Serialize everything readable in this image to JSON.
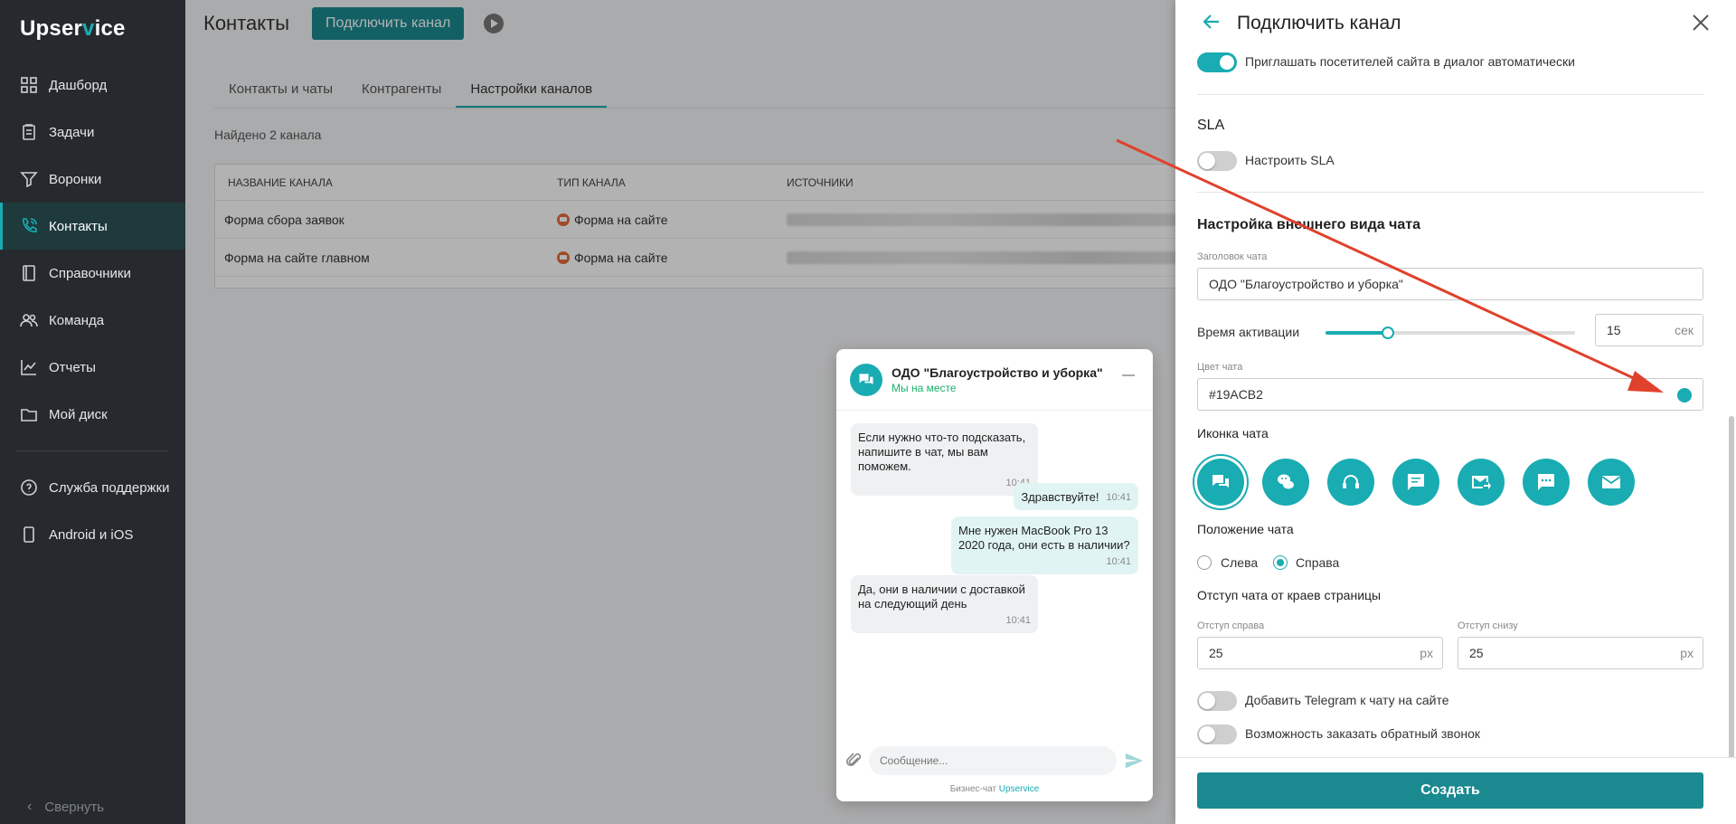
{
  "sidebar": {
    "logo_pre": "Upser",
    "logo_v": "v",
    "logo_post": "ice",
    "items": [
      {
        "label": "Дашборд"
      },
      {
        "label": "Задачи"
      },
      {
        "label": "Воронки"
      },
      {
        "label": "Контакты"
      },
      {
        "label": "Справочники"
      },
      {
        "label": "Команда"
      },
      {
        "label": "Отчеты"
      },
      {
        "label": "Мой диск"
      }
    ],
    "support": {
      "label": "Служба поддержки"
    },
    "mobile": {
      "label": "Android и iOS"
    },
    "collapse": "Свернуть"
  },
  "header": {
    "title": "Контакты",
    "connect_button": "Подключить канал"
  },
  "tabs": [
    "Контакты и чаты",
    "Контрагенты",
    "Настройки каналов"
  ],
  "found_text": "Найдено 2 канала",
  "table": {
    "columns": [
      "НАЗВАНИЕ КАНАЛА",
      "ТИП КАНАЛА",
      "ИСТОЧНИКИ"
    ],
    "rows": [
      {
        "name": "Форма сбора заявок",
        "type": "Форма на сайте"
      },
      {
        "name": "Форма на сайте главном",
        "type": "Форма на сайте"
      }
    ]
  },
  "chat_preview": {
    "name": "ОДО \"Благоустройство и уборка\"",
    "status": "Мы на месте",
    "messages": [
      {
        "text": "Если нужно что-то подсказать, напишите в чат, мы вам поможем.",
        "time": "10:41"
      },
      {
        "text": "Здравствуйте!",
        "time": "10:41"
      },
      {
        "text": "Мне нужен MacBook Pro 13 2020 года, они есть в наличии?",
        "time": "10:41"
      },
      {
        "text": "Да, они в наличии с доставкой на следующий день",
        "time": "10:41"
      }
    ],
    "input_placeholder": "Сообщение...",
    "powered_prefix": "Бизнес-чат ",
    "powered_brand": "Upservice"
  },
  "drawer": {
    "title": "Подключить канал",
    "invite_toggle": "Приглашать посетителей сайта в диалог автоматически",
    "sla_heading": "SLA",
    "sla_toggle": "Настроить SLA",
    "appearance_heading": "Настройка внешнего вида чата",
    "chat_title_label": "Заголовок чата",
    "chat_title_value": "ОДО \"Благоустройство и уборка\"",
    "activation_label": "Время активации",
    "activation_value": "15",
    "activation_unit": "сек",
    "activation_slider_fraction": 0.25,
    "color_label": "Цвет чата",
    "color_value": "#19ACB2",
    "icon_heading": "Иконка чата",
    "icons": [
      "chat-bubbles-icon",
      "wechat-icon",
      "headset-icon",
      "message-square-icon",
      "email-forward-icon",
      "speech-dots-icon",
      "envelope-icon"
    ],
    "position_heading": "Положение чата",
    "position_left": "Слева",
    "position_right": "Справа",
    "offset_heading": "Отступ чата от краев страницы",
    "offset_right_label": "Отступ справа",
    "offset_right_value": "25",
    "offset_bottom_label": "Отступ снизу",
    "offset_bottom_value": "25",
    "px_unit": "px",
    "telegram_toggle": "Добавить Telegram к чату на сайте",
    "callback_toggle": "Возможность заказать обратный звонок",
    "create_button": "Создать"
  },
  "colors": {
    "accent": "#19acb2",
    "sidebar_bg": "#262a2f",
    "annotation_arrow": "#e0412c"
  }
}
